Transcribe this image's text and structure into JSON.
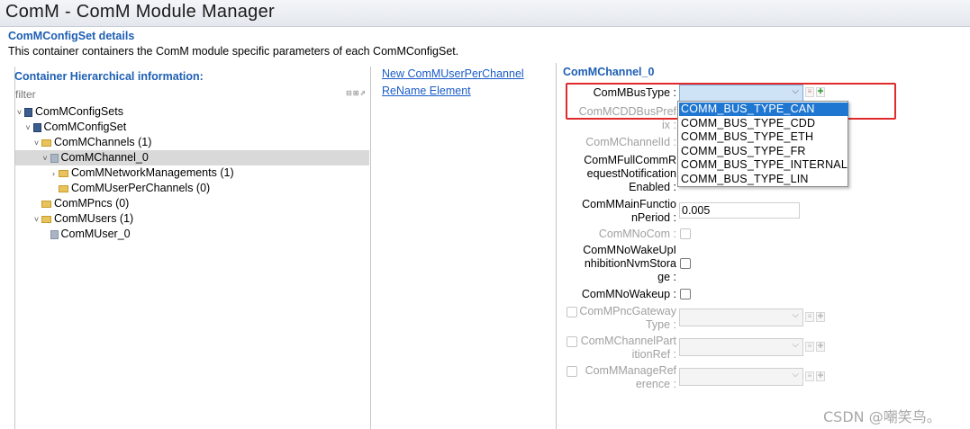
{
  "window": {
    "title": "ComM - ComM Module Manager"
  },
  "section": {
    "title": "ComMConfigSet details",
    "description": "This container containers the ComM module specific parameters of each ComMConfigSet."
  },
  "left_panel": {
    "heading": "Container Hierarchical information:",
    "filter_placeholder": "filter",
    "filter_icons": "⊟⊞⇗",
    "tree": [
      {
        "label": "ComMConfigSets",
        "twisty": "˅",
        "icon": "node-icon",
        "depth": 0,
        "selected": false
      },
      {
        "label": "ComMConfigSet",
        "twisty": "˅",
        "icon": "node-icon",
        "depth": 1,
        "selected": false
      },
      {
        "label": "ComMChannels (1)",
        "twisty": "˅",
        "icon": "folder-icon",
        "depth": 2,
        "selected": false
      },
      {
        "label": "ComMChannel_0",
        "twisty": "˅",
        "icon": "item-icon",
        "depth": 3,
        "selected": true
      },
      {
        "label": "ComMNetworkManagements (1)",
        "twisty": "›",
        "icon": "folder-icon",
        "depth": 4,
        "selected": false
      },
      {
        "label": "ComMUserPerChannels (0)",
        "twisty": "",
        "icon": "folder-icon",
        "depth": 4,
        "selected": false
      },
      {
        "label": "ComMPncs (0)",
        "twisty": "",
        "icon": "folder-icon",
        "depth": 2,
        "selected": false
      },
      {
        "label": "ComMUsers (1)",
        "twisty": "˅",
        "icon": "folder-icon",
        "depth": 2,
        "selected": false
      },
      {
        "label": "ComMUser_0",
        "twisty": "",
        "icon": "item-icon",
        "depth": 3,
        "selected": false
      }
    ]
  },
  "actions": {
    "new_link": "New ComMUserPerChannel",
    "rename_link": "ReName Element"
  },
  "right_panel": {
    "heading": "ComMChannel_0",
    "fields": {
      "bus_type": {
        "label": "ComMBusType :",
        "value": ""
      },
      "cdd_bus_prefix": {
        "label": "ComMCDDBusPref\nix :"
      },
      "channel_id": {
        "label": "ComMChannelId :"
      },
      "full_comm_req": {
        "label": "ComMFullCommR\nequestNotification\nEnabled :"
      },
      "main_function_period": {
        "label": "ComMMainFunctio\nnPeriod :",
        "value": "0.005"
      },
      "no_com": {
        "label": "ComMNoCom :"
      },
      "no_wakeup_inhibition": {
        "label": "ComMNoWakeUpI\nnhibitionNvmStora\nge :"
      },
      "no_wakeup": {
        "label": "ComMNoWakeup :"
      },
      "pnc_gateway_type": {
        "label": "ComMPncGateway\nType :"
      },
      "channel_partition_ref": {
        "label": "ComMChannelPart\nitionRef :"
      },
      "manage_reference": {
        "label": "ComMManageRef\nerence :"
      }
    },
    "bus_type_options": [
      "COMM_BUS_TYPE_CAN",
      "COMM_BUS_TYPE_CDD",
      "COMM_BUS_TYPE_ETH",
      "COMM_BUS_TYPE_FR",
      "COMM_BUS_TYPE_INTERNAL",
      "COMM_BUS_TYPE_LIN"
    ],
    "selected_option": "COMM_BUS_TYPE_CAN",
    "icons": {
      "combo_arrow": "⌵",
      "delete": "≡",
      "add": "✚"
    }
  },
  "watermark": "CSDN @嘲笑鸟。",
  "colors": {
    "accent": "#1e5fb4",
    "link": "#1a5cc8",
    "highlight": "#e02a2a",
    "selection": "#1f77d2"
  }
}
